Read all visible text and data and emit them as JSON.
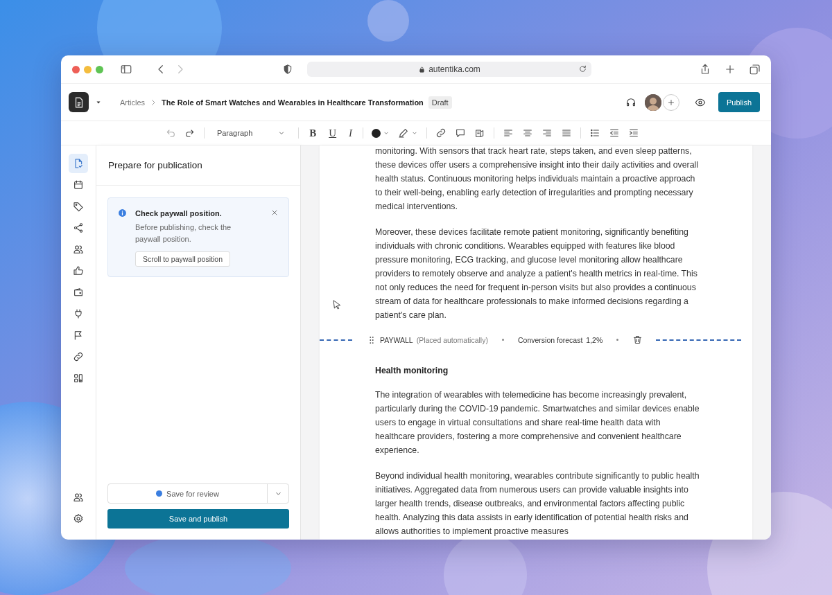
{
  "browser": {
    "url": "autentika.com"
  },
  "header": {
    "breadcrumb_parent": "Articles",
    "title": "The Role of Smart Watches and Wearables in Healthcare Transformation",
    "status": "Draft",
    "publish_button": "Publish"
  },
  "toolbar": {
    "block_style": "Paragraph",
    "format_buttons": [
      "B",
      "U",
      "I"
    ]
  },
  "rail": {
    "items": [
      {
        "selected": true
      },
      {
        "selected": false
      },
      {
        "selected": false
      },
      {
        "selected": false
      },
      {
        "selected": false
      },
      {
        "selected": false
      },
      {
        "selected": false
      },
      {
        "selected": false
      },
      {
        "selected": false
      },
      {
        "selected": false
      },
      {
        "selected": false
      }
    ],
    "bottom_items": [
      {
        "selected": false
      },
      {
        "selected": false
      }
    ]
  },
  "panel": {
    "title": "Prepare for publication",
    "notice": {
      "title": "Check paywall position.",
      "body": "Before publishing, check the paywall position.",
      "button": "Scroll to paywall position"
    },
    "save_for_review": "Save for review",
    "save_and_publish": "Save and publish"
  },
  "editor": {
    "blocks": [
      {
        "kind": "paragraph",
        "text": "monitoring. With sensors that track heart rate, steps taken, and even sleep patterns, these devices offer users a comprehensive insight into their daily activities and overall health status. Continuous monitoring helps individuals maintain a proactive approach to their well-being, enabling early detection of irregularities and prompting necessary medical interventions."
      },
      {
        "kind": "paragraph",
        "text": "Moreover, these devices facilitate remote patient monitoring, significantly benefiting individuals with chronic conditions. Wearables equipped with features like blood pressure monitoring, ECG tracking, and glucose level monitoring allow healthcare providers to remotely observe and analyze a patient's health metrics in real-time. This not only reduces the need for frequent in-person visits but also provides a continuous stream of data for healthcare professionals to make informed decisions regarding a patient's care plan."
      },
      {
        "kind": "paywall",
        "label": "PAYWALL",
        "note": "(Placed automatically)",
        "forecast_label": "Conversion forecast",
        "forecast_value": "1,2%"
      },
      {
        "kind": "heading",
        "text": "Health monitoring"
      },
      {
        "kind": "paragraph",
        "text": "The integration of wearables with telemedicine has become increasingly prevalent, particularly during the COVID-19 pandemic. Smartwatches and similar devices enable users to engage in virtual consultations and share real-time health data with healthcare providers, fostering a more comprehensive and convenient healthcare experience."
      },
      {
        "kind": "paragraph",
        "text": "Beyond individual health monitoring, wearables contribute significantly to public health initiatives. Aggregated data from numerous users can provide valuable insights into larger health trends, disease outbreaks, and environmental factors affecting public health. Analyzing this data assists in early identification of potential health risks and allows authorities to implement proactive measures"
      }
    ]
  }
}
